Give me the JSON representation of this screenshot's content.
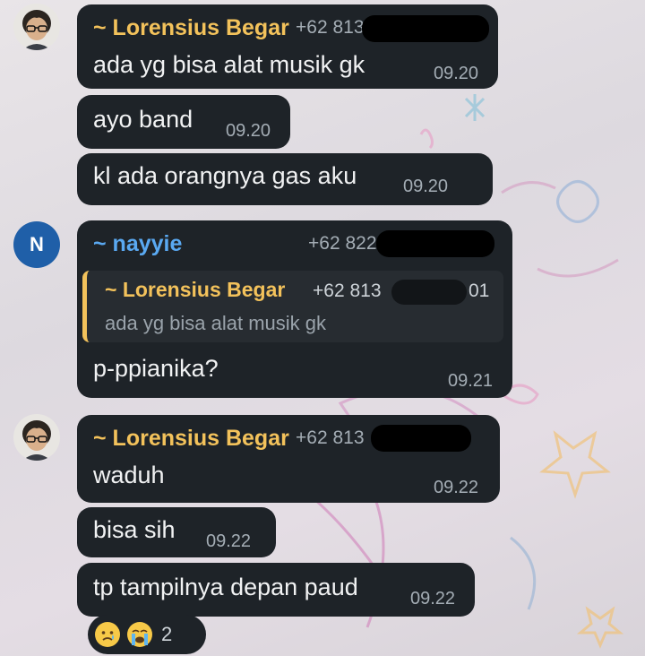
{
  "messages": [
    {
      "sender": "~ Lorensius Begar",
      "phone": "+62 813",
      "bubbles": [
        {
          "text": "ada yg bisa alat musik gk",
          "time": "09.20"
        },
        {
          "text": "ayo band",
          "time": "09.20"
        },
        {
          "text": "kl ada orangnya gas aku",
          "time": "09.20"
        }
      ]
    },
    {
      "sender": "~ nayyie",
      "phone": "+62 822",
      "avatar_letter": "N",
      "reply": {
        "sender": "~ Lorensius Begar",
        "phone": "+62 813",
        "phone_tail": "01",
        "text": "ada yg bisa alat musik gk"
      },
      "text": "p-ppianika?",
      "time": "09.21"
    },
    {
      "sender": "~ Lorensius Begar",
      "phone": "+62 813",
      "bubbles": [
        {
          "text": "waduh",
          "time": "09.22"
        },
        {
          "text": "bisa sih",
          "time": "09.22"
        },
        {
          "text": "tp tampilnya depan paud",
          "time": "09.22"
        }
      ],
      "reactions": {
        "emojis": [
          "sad-face-emoji",
          "crying-face-emoji"
        ],
        "count": "2"
      }
    }
  ],
  "colors": {
    "bubble": "#1e2328",
    "sender_gold": "#f3c25b",
    "sender_blue": "#5aa9f2",
    "timestamp": "#a4adb5",
    "avatar_n": "#1f5fa8"
  }
}
